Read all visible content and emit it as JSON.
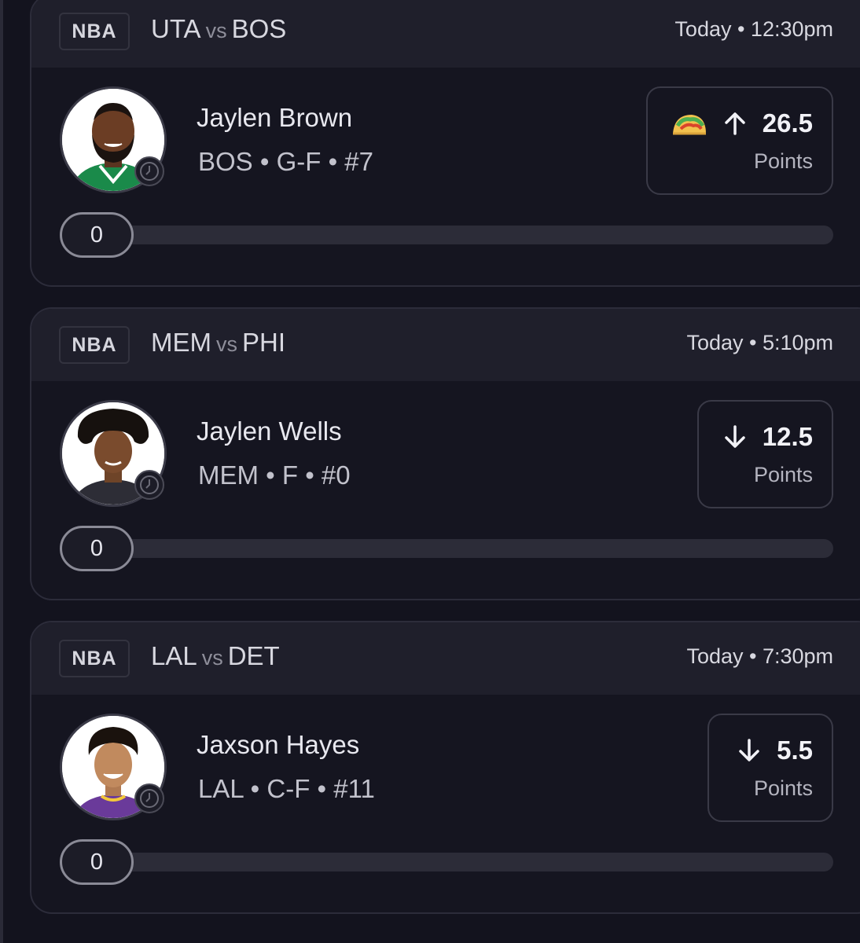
{
  "cards": [
    {
      "league": "NBA",
      "team_a": "UTA",
      "vs": "vs",
      "team_b": "BOS",
      "time": "Today • 12:30pm",
      "player_name": "Jaylen Brown",
      "player_meta": "BOS • G-F • #7",
      "pick_direction": "up",
      "pick_emoji": "taco",
      "pick_value": "26.5",
      "pick_stat": "Points",
      "progress_value": "0",
      "progress_fraction": 0,
      "jersey_color": "#1a8a4a",
      "avatar_icon": "player-headshot"
    },
    {
      "league": "NBA",
      "team_a": "MEM",
      "vs": "vs",
      "team_b": "PHI",
      "time": "Today • 5:10pm",
      "player_name": "Jaylen Wells",
      "player_meta": "MEM • F • #0",
      "pick_direction": "down",
      "pick_value": "12.5",
      "pick_stat": "Points",
      "progress_value": "0",
      "progress_fraction": 0,
      "jersey_color": "#2d2d36",
      "avatar_icon": "player-headshot"
    },
    {
      "league": "NBA",
      "team_a": "LAL",
      "vs": "vs",
      "team_b": "DET",
      "time": "Today • 7:30pm",
      "player_name": "Jaxson Hayes",
      "player_meta": "LAL • C-F • #11",
      "pick_direction": "down",
      "pick_value": "5.5",
      "pick_stat": "Points",
      "progress_value": "0",
      "progress_fraction": 0,
      "jersey_color": "#6a3a9a",
      "avatar_icon": "player-headshot"
    }
  ],
  "colors": {
    "background": "#13131e",
    "card": "#151520",
    "header": "#1f1f2b",
    "accent_text": "#f2f2f7"
  }
}
